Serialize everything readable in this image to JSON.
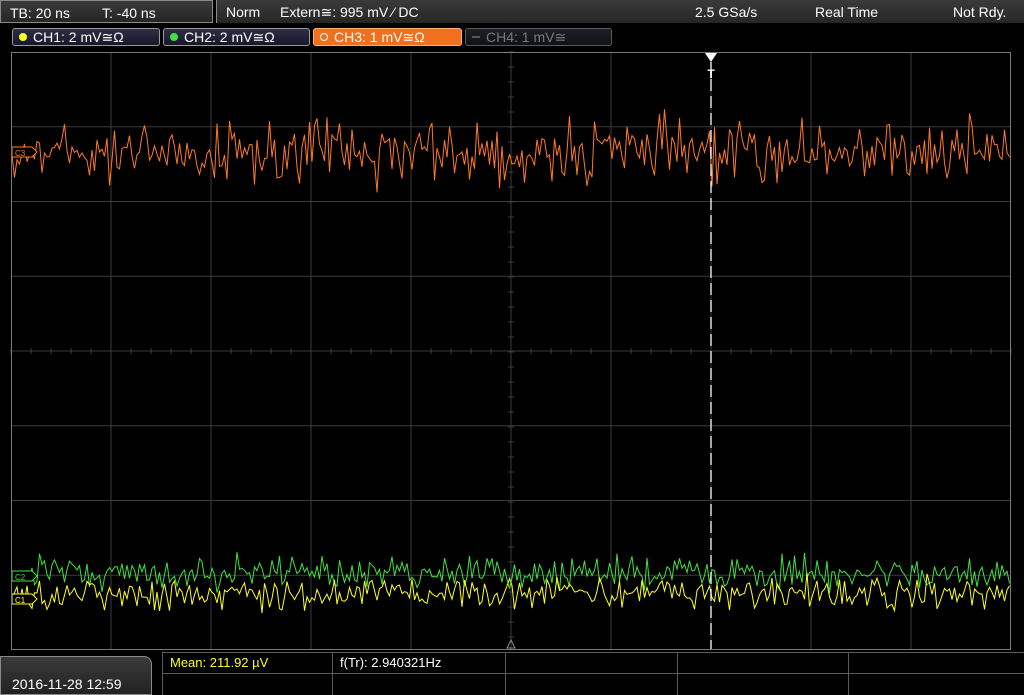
{
  "topbar": {
    "timebase": "TB: 20 ns",
    "trigger_time": "T: -40 ns",
    "mode": "Norm",
    "trigger_source": "Extern≅: 995 mV ⁄ DC",
    "sample_rate": "2.5 GSa/s",
    "acq_mode": "Real Time",
    "status": "Not Rdy."
  },
  "channels": [
    {
      "label": "CH1: 2 mV≅Ω",
      "color": "#ffff20",
      "state": "on"
    },
    {
      "label": "CH2: 2 mV≅Ω",
      "color": "#40e040",
      "state": "on"
    },
    {
      "label": "CH3: 1 mV≅Ω",
      "color": "#ff7a20",
      "state": "active"
    },
    {
      "label": "CH4: 1 mV≅",
      "color": "#7a7a7a",
      "state": "off"
    }
  ],
  "markers": {
    "ch3": "C3",
    "ch2": "C2",
    "ch1": "C1",
    "trigger": "T"
  },
  "colors": {
    "ch1": "#ffff20",
    "ch2": "#40e040",
    "ch3": "#ff7a20",
    "grid": "#3c3c3c",
    "background": "#000000"
  },
  "bottom": {
    "datetime": "2016-11-28 12:59",
    "mean": "Mean: 211.92 µV",
    "freq": "f(Tr): 2.940321Hz"
  }
}
